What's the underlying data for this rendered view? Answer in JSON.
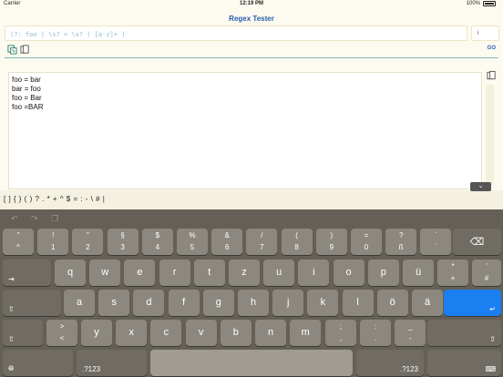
{
  "status": {
    "carrier": "Carrier",
    "time": "12:19 PM",
    "battery": "100%"
  },
  "nav": {
    "title": "Regex Tester"
  },
  "pattern": {
    "value": "(?: foo ) \\s? = \\s? ( [a-z]+ )",
    "flags": "i"
  },
  "actions": {
    "go_label": "GO"
  },
  "test_text": {
    "lines": [
      "foo = bar",
      "bar = foo",
      "foo = Bar",
      "foo =BAR"
    ]
  },
  "regex_symbols": "[ ] { } ( ) ? . * + ^ $ = : - \\ # |",
  "keyboard": {
    "row1": [
      {
        "top": "\"",
        "bot": "^"
      },
      {
        "top": "!",
        "bot": "1"
      },
      {
        "top": "\"",
        "bot": "2"
      },
      {
        "top": "§",
        "bot": "3"
      },
      {
        "top": "$",
        "bot": "4"
      },
      {
        "top": "%",
        "bot": "5"
      },
      {
        "top": "&",
        "bot": "6"
      },
      {
        "top": "/",
        "bot": "7"
      },
      {
        "top": "(",
        "bot": "8"
      },
      {
        "top": ")",
        "bot": "9"
      },
      {
        "top": "=",
        "bot": "0"
      },
      {
        "top": "?",
        "bot": "ß"
      },
      {
        "top": "`",
        "bot": "´"
      }
    ],
    "row2": [
      "q",
      "w",
      "e",
      "r",
      "t",
      "z",
      "u",
      "i",
      "o",
      "p",
      "ü"
    ],
    "row2_extra": {
      "top": "*",
      "bot": "+"
    },
    "row2_extra2": {
      "top": "'",
      "bot": "#"
    },
    "row3": [
      "a",
      "s",
      "d",
      "f",
      "g",
      "h",
      "j",
      "k",
      "l",
      "ö",
      "ä"
    ],
    "row4_first": {
      "top": ">",
      "bot": "<"
    },
    "row4": [
      "y",
      "x",
      "c",
      "v",
      "b",
      "n",
      "m"
    ],
    "row4_punct": [
      {
        "top": ";",
        "bot": ","
      },
      {
        "top": ":",
        "bot": "."
      },
      {
        "top": "_",
        "bot": "-"
      }
    ],
    "numbers_label": ".?123"
  }
}
